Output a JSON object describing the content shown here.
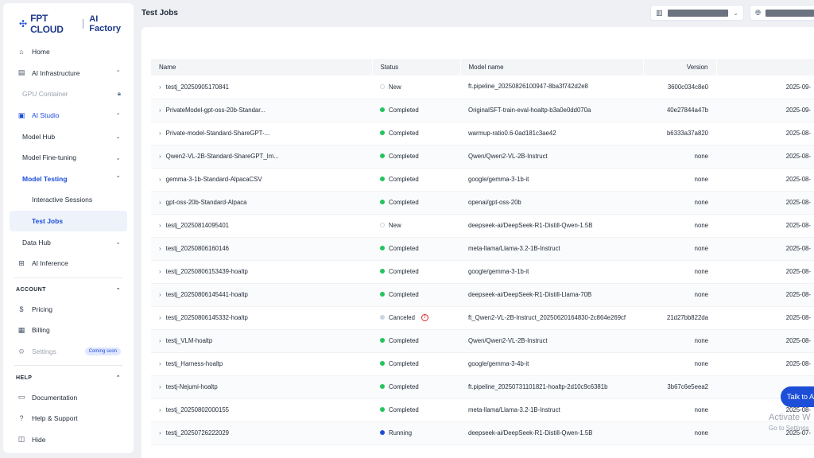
{
  "brand": {
    "name": "FPT CLOUD",
    "product": "AI Factory"
  },
  "sidebar": {
    "home": "Home",
    "ai_infrastructure": "AI Infrastructure",
    "gpu_container": "GPU Container",
    "ai_studio": "AI Studio",
    "model_hub": "Model Hub",
    "model_fine_tuning": "Model Fine-tuning",
    "model_testing": "Model Testing",
    "interactive_sessions": "Interactive Sessions",
    "test_jobs": "Test Jobs",
    "data_hub": "Data Hub",
    "ai_inference": "AI Inference",
    "account_heading": "ACCOUNT",
    "pricing": "Pricing",
    "billing": "Billing",
    "settings": "Settings",
    "coming_soon": "Coming soon",
    "help_heading": "HELP",
    "documentation": "Documentation",
    "help_support": "Help & Support",
    "hide": "Hide"
  },
  "header": {
    "title": "Test Jobs"
  },
  "table": {
    "columns": [
      "Name",
      "Status",
      "Model name",
      "Version"
    ],
    "rows": [
      {
        "name": "testj_20250905170841",
        "status": "New",
        "model": "ft.pipeline_20250826100947-8ba3f742d2e8",
        "version": "3600c034c8e0",
        "date": "2025-09-"
      },
      {
        "name": "PrivateModel-gpt-oss-20b-Standar...",
        "status": "Completed",
        "model": "OriginalSFT-train-eval-hoaltp-b3a0e0dd070a",
        "version": "40e27844a47b",
        "date": "2025-09-"
      },
      {
        "name": "Private-model-Standard-ShareGPT-...",
        "status": "Completed",
        "model": "warmup-ratio0.6-0ad181c3ae42",
        "version": "b6333a37a820",
        "date": "2025-08-"
      },
      {
        "name": "Qwen2-VL-2B-Standard-ShareGPT_Im...",
        "status": "Completed",
        "model": "Qwen/Qwen2-VL-2B-Instruct",
        "version": "none",
        "date": "2025-08-"
      },
      {
        "name": "gemma-3-1b-Standard-AlpacaCSV",
        "status": "Completed",
        "model": "google/gemma-3-1b-it",
        "version": "none",
        "date": "2025-08-"
      },
      {
        "name": "gpt-oss-20b-Standard-Alpaca",
        "status": "Completed",
        "model": "openai/gpt-oss-20b",
        "version": "none",
        "date": "2025-08-"
      },
      {
        "name": "testj_20250814095401",
        "status": "New",
        "model": "deepseek-ai/DeepSeek-R1-Distill-Qwen-1.5B",
        "version": "none",
        "date": "2025-08-"
      },
      {
        "name": "testj_20250806160146",
        "status": "Completed",
        "model": "meta-llama/Llama-3.2-1B-Instruct",
        "version": "none",
        "date": "2025-08-"
      },
      {
        "name": "testj_20250806153439-hoaltp",
        "status": "Completed",
        "model": "google/gemma-3-1b-it",
        "version": "none",
        "date": "2025-08-"
      },
      {
        "name": "testj_20250806145441-hoaltp",
        "status": "Completed",
        "model": "deepseek-ai/DeepSeek-R1-Distill-Llama-70B",
        "version": "none",
        "date": "2025-08-"
      },
      {
        "name": "testj_20250806145332-hoaltp",
        "status": "Canceled",
        "model": "ft_Qwen2-VL-2B-Instruct_20250620164830-2c864e269cf",
        "version": "21d27bb822da",
        "date": "2025-08-"
      },
      {
        "name": "testj_VLM-hoaltp",
        "status": "Completed",
        "model": "Qwen/Qwen2-VL-2B-Instruct",
        "version": "none",
        "date": "2025-08-"
      },
      {
        "name": "testj_Harness-hoaltp",
        "status": "Completed",
        "model": "google/gemma-3-4b-it",
        "version": "none",
        "date": "2025-08-"
      },
      {
        "name": "testj-Nejumi-hoaltp",
        "status": "Completed",
        "model": "ft.pipeline_20250731101821-hoaltp-2d10c9c6381b",
        "version": "3b67c6e5eea2",
        "date": ""
      },
      {
        "name": "testj_20250802000155",
        "status": "Completed",
        "model": "meta-llama/Llama-3.2-1B-Instruct",
        "version": "none",
        "date": "2025-08-"
      },
      {
        "name": "testj_20250726222029",
        "status": "Running",
        "model": "deepseek-ai/DeepSeek-R1-Distill-Qwen-1.5B",
        "version": "none",
        "date": "2025-07-"
      }
    ]
  },
  "floating": {
    "talk_label": "Talk to A",
    "activate_title": "Activate W",
    "activate_sub": "Go to Settings"
  },
  "colors": {
    "accent": "#1d4ed8",
    "completed": "#22c55e",
    "canceled_alert": "#dc2626"
  }
}
